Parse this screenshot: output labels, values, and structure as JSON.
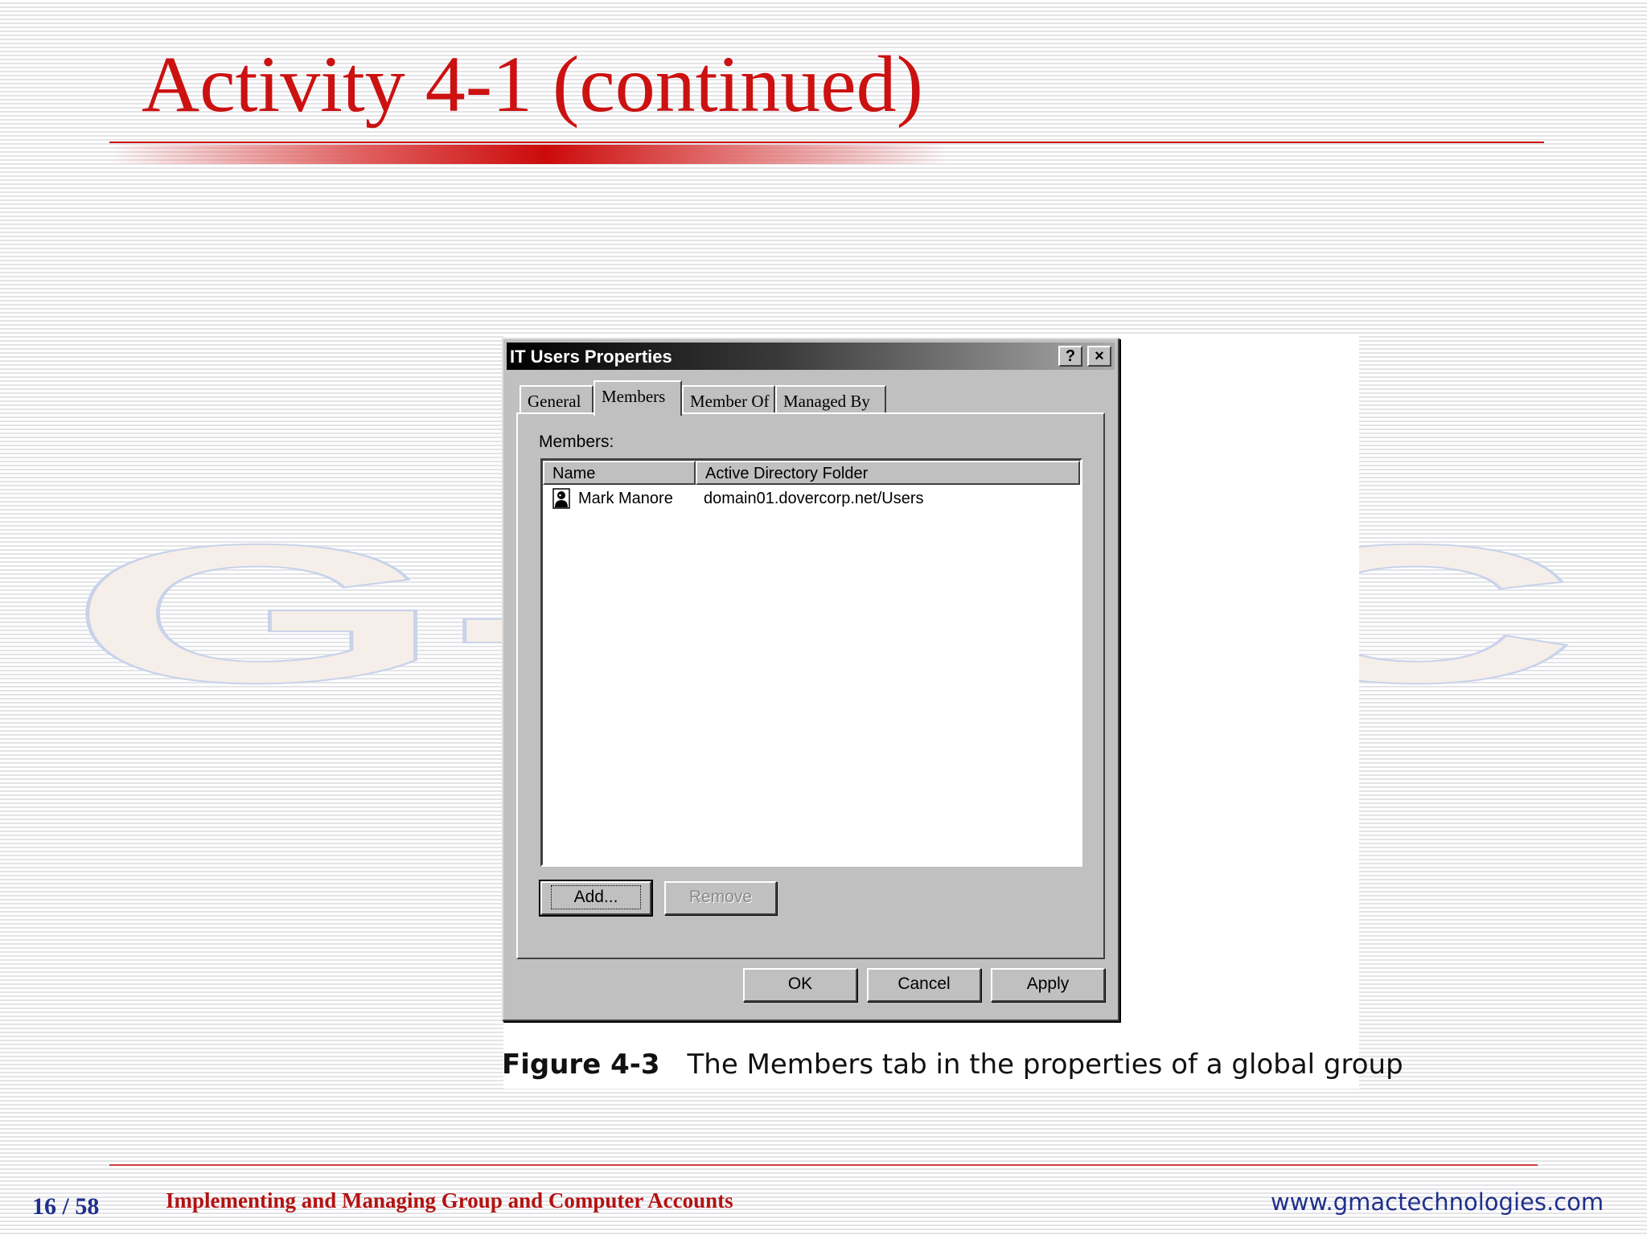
{
  "slide": {
    "title": "Activity 4-1 (continued)",
    "watermark_text": "G-TEC",
    "page_number": "16 / 58",
    "footer_title": "Implementing and Managing Group and Computer Accounts",
    "footer_url": "www.gmactechnologies.com",
    "colors": {
      "title": "#cc1111",
      "footer_blue": "#1f2f8a",
      "footer_red": "#b31212"
    }
  },
  "dialog": {
    "title": "IT Users Properties",
    "help_button": "?",
    "close_button": "×",
    "tabs": [
      {
        "label": "General",
        "active": false
      },
      {
        "label": "Members",
        "active": true
      },
      {
        "label": "Member Of",
        "active": false
      },
      {
        "label": "Managed By",
        "active": false
      }
    ],
    "members_label": "Members:",
    "list": {
      "columns": [
        "Name",
        "Active Directory Folder"
      ],
      "rows": [
        {
          "icon": "user-icon",
          "name": "Mark Manore",
          "folder": "domain01.dovercorp.net/Users"
        }
      ]
    },
    "add_button": "Add...",
    "remove_button": "Remove",
    "ok_button": "OK",
    "cancel_button": "Cancel",
    "apply_button": "Apply"
  },
  "figure": {
    "number": "Figure 4-3",
    "caption": "The Members tab in the properties of a global group"
  }
}
